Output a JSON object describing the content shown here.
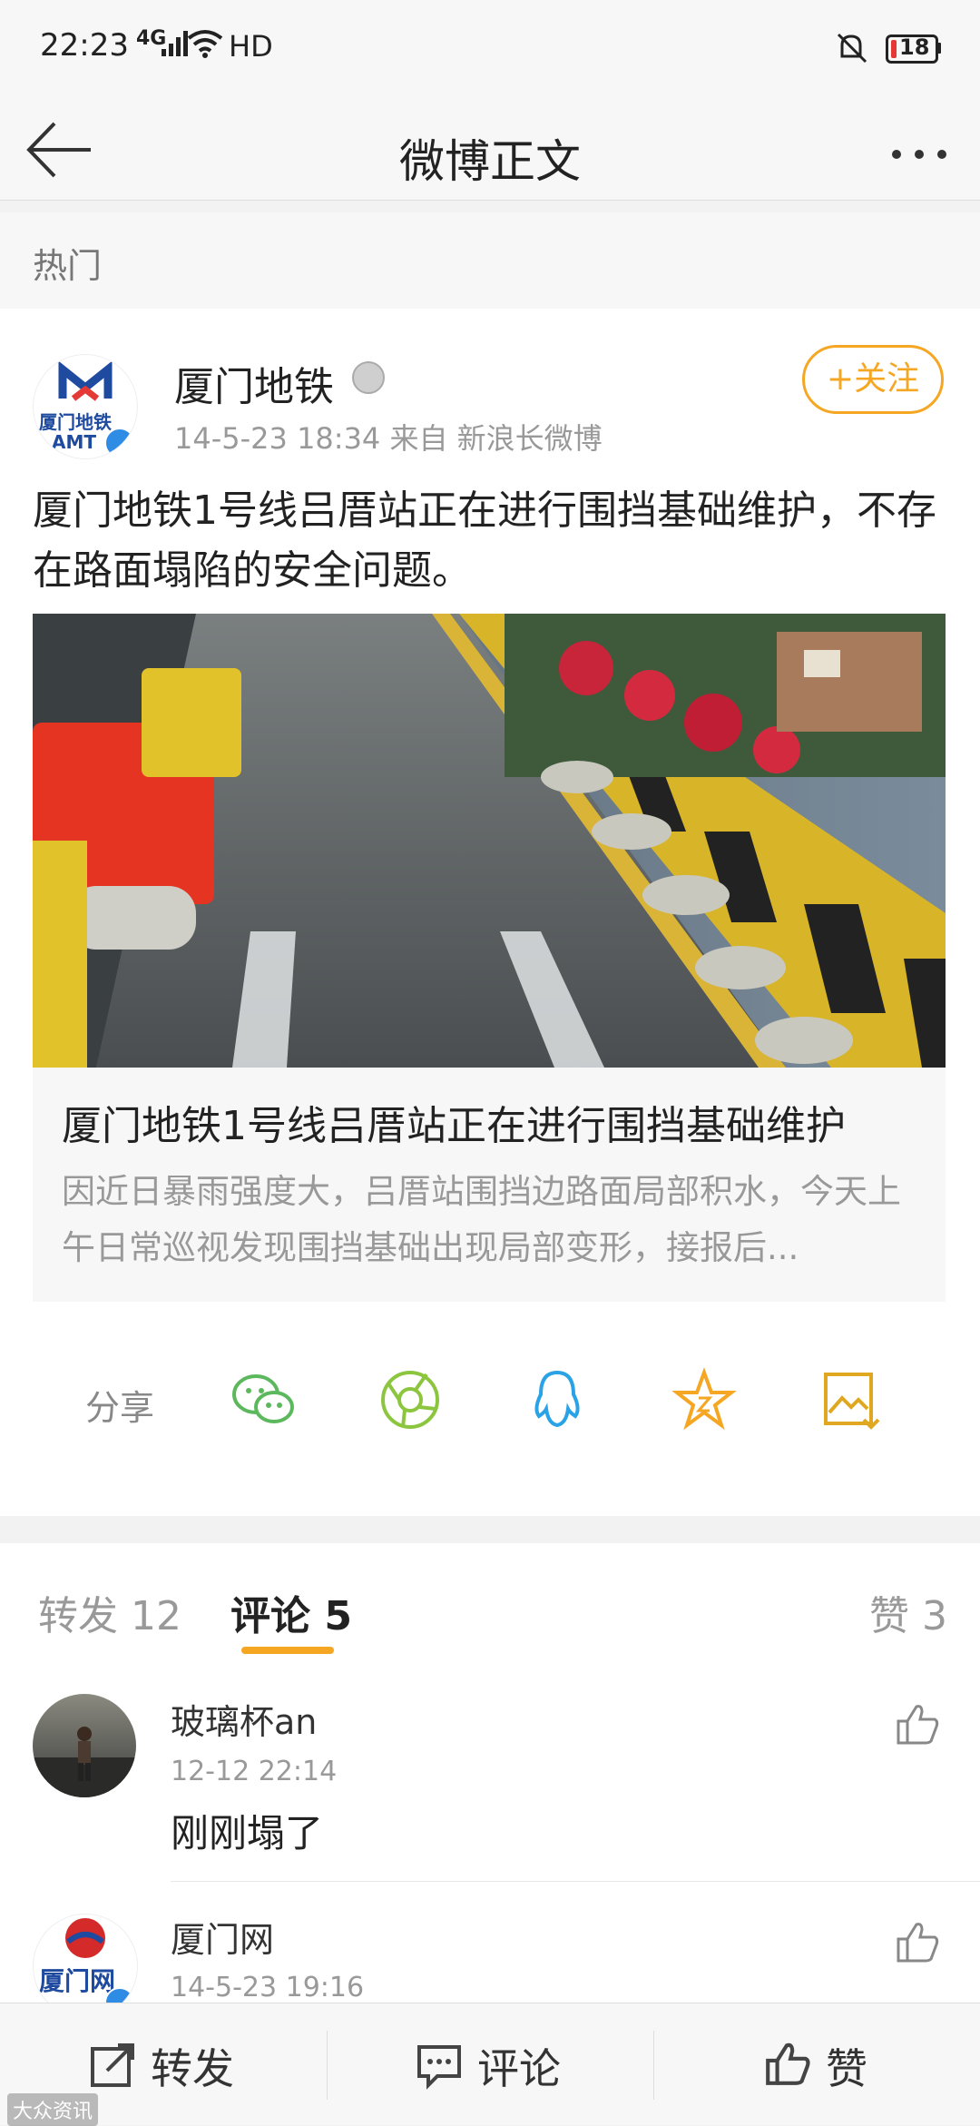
{
  "status_bar": {
    "time": "22:23",
    "network": "4G",
    "hd": "HD",
    "battery": "18"
  },
  "nav": {
    "title": "微博正文"
  },
  "section": {
    "label": "热门"
  },
  "post": {
    "author": "厦门地铁",
    "avatar_text": "厦门地铁",
    "avatar_sub": "AMT",
    "meta": "14-5-23 18:34  来自 新浪长微博",
    "follow": "+关注",
    "text": "厦门地铁1号线吕厝站正在进行围挡基础维护，不存在路面塌陷的安全问题。",
    "card": {
      "title": "厦门地铁1号线吕厝站正在进行围挡基础维护",
      "desc": "因近日暴雨强度大，吕厝站围挡边路面局部积水，今天上午日常巡视发现围挡基础出现局部变形，接报后..."
    }
  },
  "share": {
    "label": "分享"
  },
  "tabs": {
    "repost": "转发 12",
    "comment": "评论 5",
    "like": "赞 3"
  },
  "comments": [
    {
      "name": "玻璃杯an",
      "time": "12-12 22:14",
      "text": "刚刚塌了"
    },
    {
      "name": "厦门网",
      "time": "14-5-23 19:16",
      "avatar_text": "厦门网"
    }
  ],
  "bottom_bar": {
    "repost": "转发",
    "comment": "评论",
    "like": "赞"
  },
  "watermark": "大众资讯",
  "colors": {
    "accent": "#f5a623",
    "wechat": "#5cb85c",
    "qq": "#2aa3e6"
  }
}
